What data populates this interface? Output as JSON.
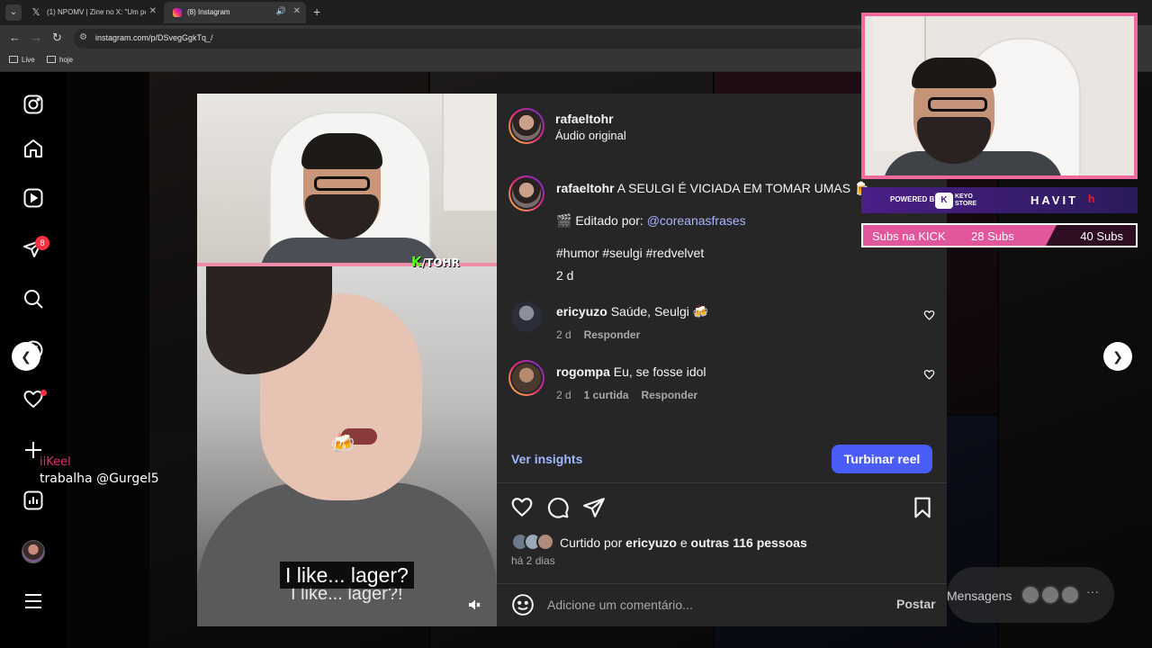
{
  "browser": {
    "tabs": [
      {
        "title": "(1) NPOMV | Zine no X: \"Um po",
        "favicon": "x-logo",
        "close": "✕"
      },
      {
        "title": "(8) Instagram",
        "favicon": "instagram-logo",
        "close": "✕",
        "active": true
      }
    ],
    "url": "instagram.com/p/DSvegGgkTq_/",
    "bookmarks": [
      {
        "label": "Live"
      },
      {
        "label": "hoje"
      }
    ]
  },
  "sidenav": {
    "icons": [
      "instagram-icon",
      "home-icon",
      "reels-icon",
      "messages-icon",
      "search-icon",
      "explore-icon",
      "notifications-icon",
      "create-icon",
      "dashboard-icon",
      "profile-avatar",
      "menu-icon"
    ],
    "messages_badge": "8"
  },
  "stream_chat": {
    "user": "iiKeel",
    "message": "trabalha @Gurgel5"
  },
  "media": {
    "subtitle": "I like... lager?",
    "subtitle_echo": "I like... lager?!",
    "kick_watermark": "K",
    "kick_handle": "/TOHR"
  },
  "post": {
    "author": "rafaeltohr",
    "audio": "Áudio original",
    "caption": {
      "author": "rafaeltohr",
      "text": "A SEULGI É VICIADA EM TOMAR UMAS 🍺",
      "edited_label": "🎬 Editado por:",
      "edited_by": "@coreanasfrases",
      "hashtags": "#humor #seulgi #redvelvet",
      "time": "2 d"
    },
    "comments": [
      {
        "user": "ericyuzo",
        "text": "Saúde, Seulgi 🍻",
        "time": "2 d",
        "likes": "",
        "reply": "Responder"
      },
      {
        "user": "rogompa",
        "text": "Eu, se fosse idol",
        "time": "2 d",
        "likes": "1 curtida",
        "reply": "Responder"
      }
    ],
    "insights_label": "Ver insights",
    "boost_label": "Turbinar reel",
    "liked_prefix": "Curtido por",
    "liked_user": "ericyuzo",
    "liked_and": "e",
    "liked_others": "outras 116 pessoas",
    "date": "há 2 dias",
    "comment_placeholder": "Adicione um comentário...",
    "post_label": "Postar"
  },
  "stream_overlay": {
    "sponsor_prefix": "POWERED BY",
    "sponsor_brand_1_mark": "K",
    "sponsor_brand_1": "KEYO STORE",
    "sponsor_brand_2": "HAVIT",
    "sponsor_brand_2_mark": "h",
    "subs_label": "Subs na KICK",
    "subs_current": "28 Subs",
    "subs_goal": "40 Subs"
  },
  "messages_pill": {
    "label": "Mensagens",
    "more": "···"
  },
  "colors": {
    "accent": "#4a5df9",
    "ig_bg": "#262626",
    "notification": "#ff3040",
    "overlay_pink": "#f06a9e",
    "kick_green": "#53fc18"
  }
}
